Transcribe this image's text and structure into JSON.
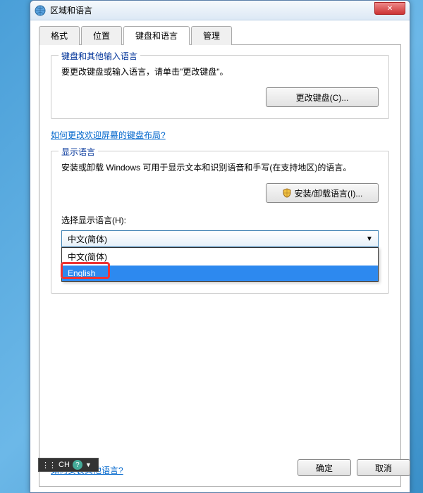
{
  "window": {
    "title": "区域和语言",
    "close_symbol": "✕"
  },
  "tabs": [
    {
      "label": "格式"
    },
    {
      "label": "位置"
    },
    {
      "label": "键盘和语言",
      "active": true
    },
    {
      "label": "管理"
    }
  ],
  "keyboard_group": {
    "title": "键盘和其他输入语言",
    "text": "要更改键盘或输入语言，请单击\"更改键盘\"。",
    "button_label": "更改键盘(C)...",
    "link_label": "如何更改欢迎屏幕的键盘布局?"
  },
  "display_group": {
    "title": "显示语言",
    "text": "安装或卸载 Windows 可用于显示文本和识别语音和手写(在支持地区)的语言。",
    "install_button_label": "安装/卸载语言(I)...",
    "select_label": "选择显示语言(H):",
    "combo_selected": "中文(简体)",
    "dropdown": [
      {
        "label": "中文(简体)"
      },
      {
        "label": "English",
        "selected": true
      }
    ]
  },
  "footer_link": "如何安装其他语言?",
  "lang_bar": {
    "code": "CH",
    "help": "?"
  },
  "buttons": {
    "ok": "确定",
    "cancel": "取消"
  }
}
